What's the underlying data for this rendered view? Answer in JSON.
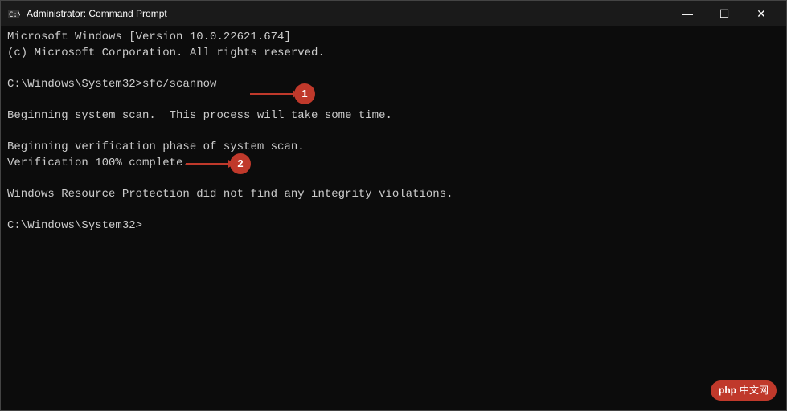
{
  "window": {
    "title": "Administrator: Command Prompt",
    "icon": "cmd-icon"
  },
  "titlebar": {
    "minimize_label": "—",
    "maximize_label": "☐",
    "close_label": "✕"
  },
  "terminal": {
    "lines": [
      "Microsoft Windows [Version 10.0.22621.674]",
      "(c) Microsoft Corporation. All rights reserved.",
      "",
      "C:\\Windows\\System32>sfc/scannow",
      "",
      "Beginning system scan.  This process will take some time.",
      "",
      "Beginning verification phase of system scan.",
      "Verification 100% complete.",
      "",
      "Windows Resource Protection did not find any integrity violations.",
      "",
      "C:\\Windows\\System32>"
    ]
  },
  "annotations": [
    {
      "number": "1",
      "label": "annotation-1"
    },
    {
      "number": "2",
      "label": "annotation-2"
    }
  ],
  "watermark": {
    "text": "php中文网"
  }
}
